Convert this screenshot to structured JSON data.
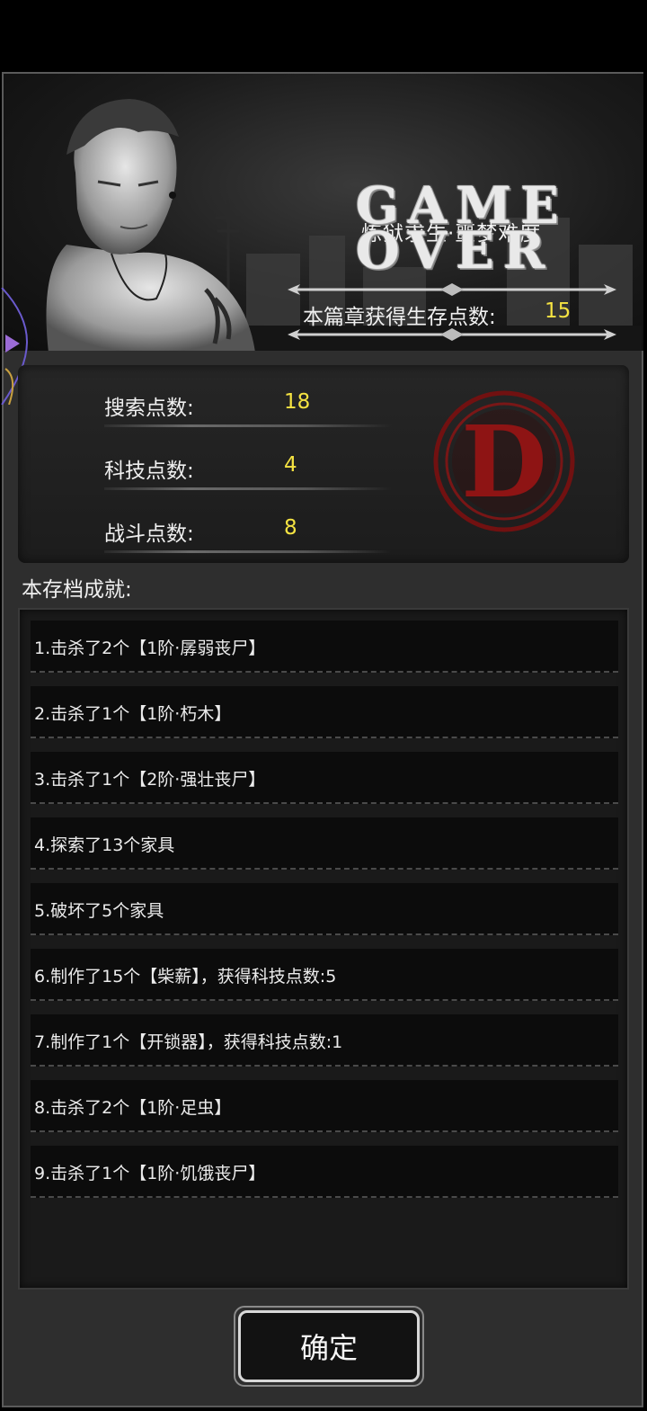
{
  "banner": {
    "chapter_title": "炼狱求生·噩梦难度",
    "game_over_line1": "GAME",
    "game_over_line2": "OVER",
    "points_label": "本篇章获得生存点数:",
    "points_value": "15"
  },
  "stats": [
    {
      "label": "搜索点数:",
      "value": "18"
    },
    {
      "label": "科技点数:",
      "value": "4"
    },
    {
      "label": "战斗点数:",
      "value": "8"
    }
  ],
  "grade": "D",
  "achievements_title": "本存档成就:",
  "achievements": [
    "1.击杀了2个【1阶·孱弱丧尸】",
    "2.击杀了1个【1阶·朽木】",
    "3.击杀了1个【2阶·强壮丧尸】",
    "4.探索了13个家具",
    "5.破坏了5个家具",
    "6.制作了15个【柴薪】，获得科技点数:5",
    "7.制作了1个【开锁器】，获得科技点数:1",
    "8.击杀了2个【1阶·足虫】",
    "9.击杀了1个【1阶·饥饿丧尸】"
  ],
  "confirm_label": "确定",
  "colors": {
    "value_yellow": "#f5e342",
    "grade_red": "#8e1414",
    "panel_bg": "#2e2e2e"
  }
}
